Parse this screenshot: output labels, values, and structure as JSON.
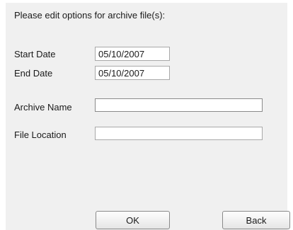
{
  "dialog": {
    "instruction": "Please edit options for archive file(s):",
    "start_date": {
      "label": "Start Date",
      "value": "05/10/2007"
    },
    "end_date": {
      "label": "End Date",
      "value": "05/10/2007"
    },
    "archive_name": {
      "label": "Archive Name",
      "value": ""
    },
    "file_location": {
      "label": "File Location",
      "value": ""
    },
    "ok_label": "OK",
    "back_label": "Back"
  }
}
